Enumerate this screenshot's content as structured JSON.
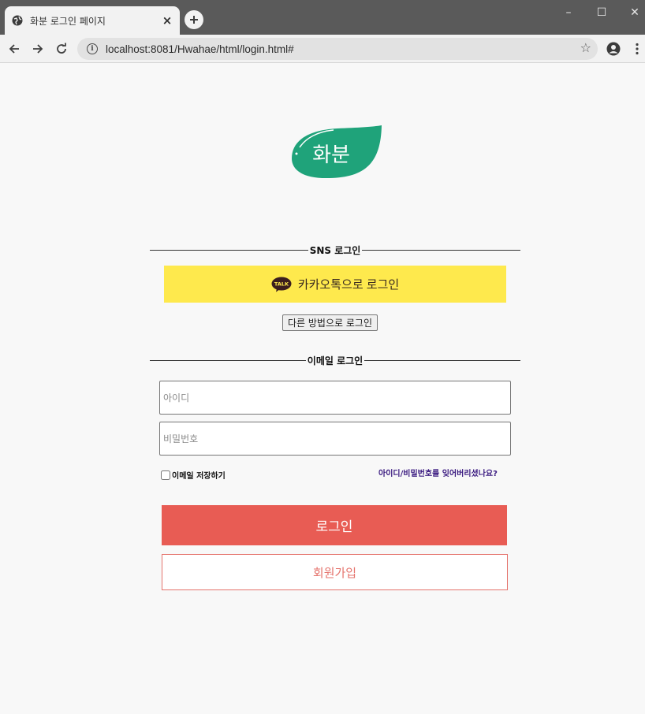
{
  "browser": {
    "tab_title": "화분 로그인 페이지",
    "tab_close": "×",
    "new_tab": "+",
    "url": "localhost:8081/Hwahae/html/login.html#",
    "window_controls": [
      "–",
      "☐",
      "✕"
    ]
  },
  "logo": {
    "text": "화분",
    "color": "#1fa37a"
  },
  "sns": {
    "heading": "SNS 로그인",
    "kakao_label": "카카오톡으로 로그인",
    "kakao_icon_text": "TALK",
    "other_label": "다른 방법으로 로그인"
  },
  "email": {
    "heading": "이메일 로그인",
    "id_placeholder": "아이디",
    "pw_placeholder": "비밀번호",
    "save_label": "이메일 저장하기",
    "forgot_label": "아이디/비밀번호를 잊어버리셨나요?"
  },
  "buttons": {
    "login": "로그인",
    "join": "회원가입"
  },
  "colors": {
    "kakao": "#fee94d",
    "login": "#e85c54",
    "join_border": "#e5736c",
    "logo": "#1fa37a"
  }
}
